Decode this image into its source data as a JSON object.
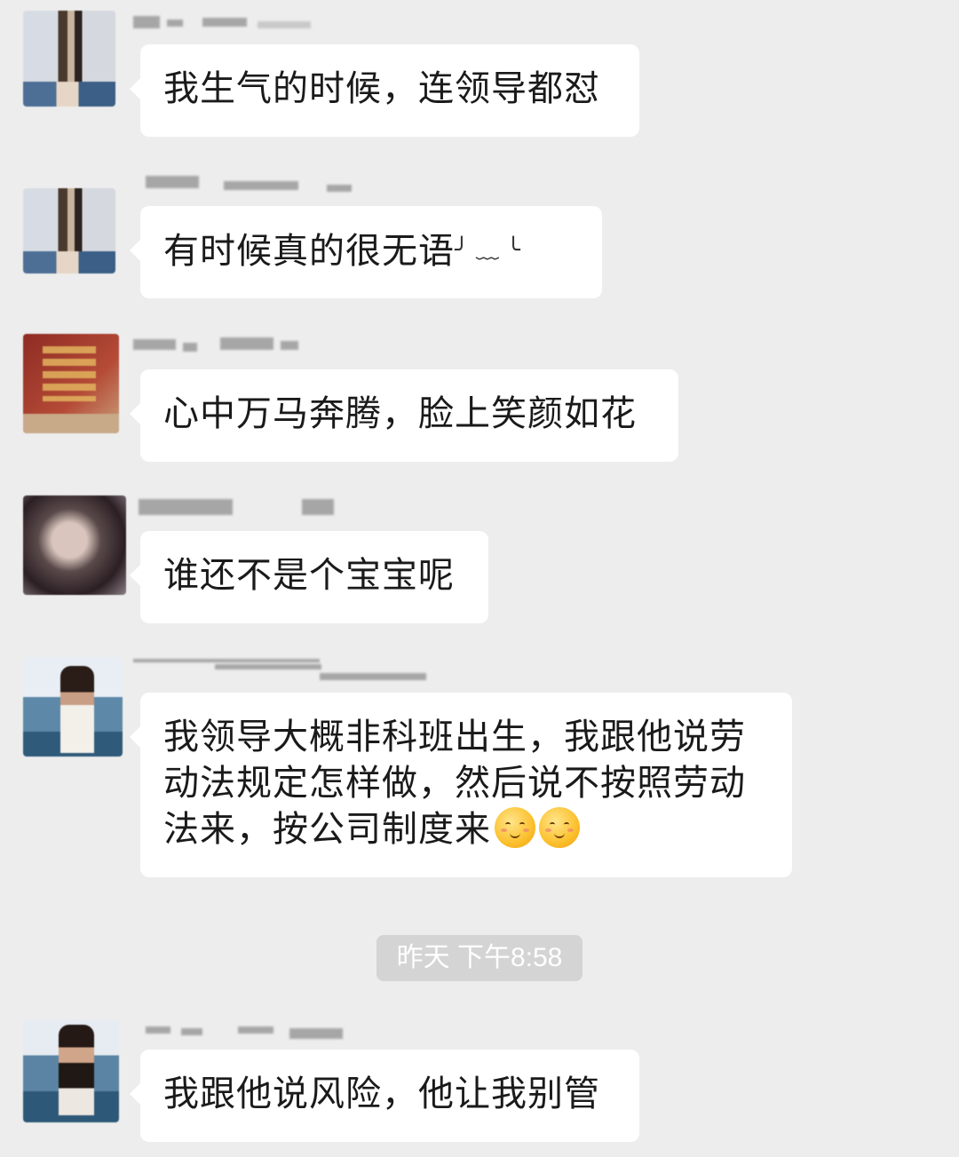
{
  "messages": [
    {
      "text": "我生气的时候，连领导都怼"
    },
    {
      "text": "有时候真的很无语",
      "suffix": "╯ ﹏ ╰"
    },
    {
      "text": "心中万马奔腾，脸上笑颜如花"
    },
    {
      "text": "谁还不是个宝宝呢"
    },
    {
      "text": "我领导大概非科班出生，我跟他说劳动法规定怎样做，然后说不按照劳动法来，按公司制度来"
    },
    {
      "text": "我跟他说风险，他让我别管"
    }
  ],
  "timestamp": "昨天 下午8:58",
  "emoji": "blushing-smile-emoji",
  "colors": {
    "background": "#ededed",
    "bubble": "#ffffff",
    "timestamp_bg": "#d4d4d4",
    "text": "#1a1a1a"
  }
}
